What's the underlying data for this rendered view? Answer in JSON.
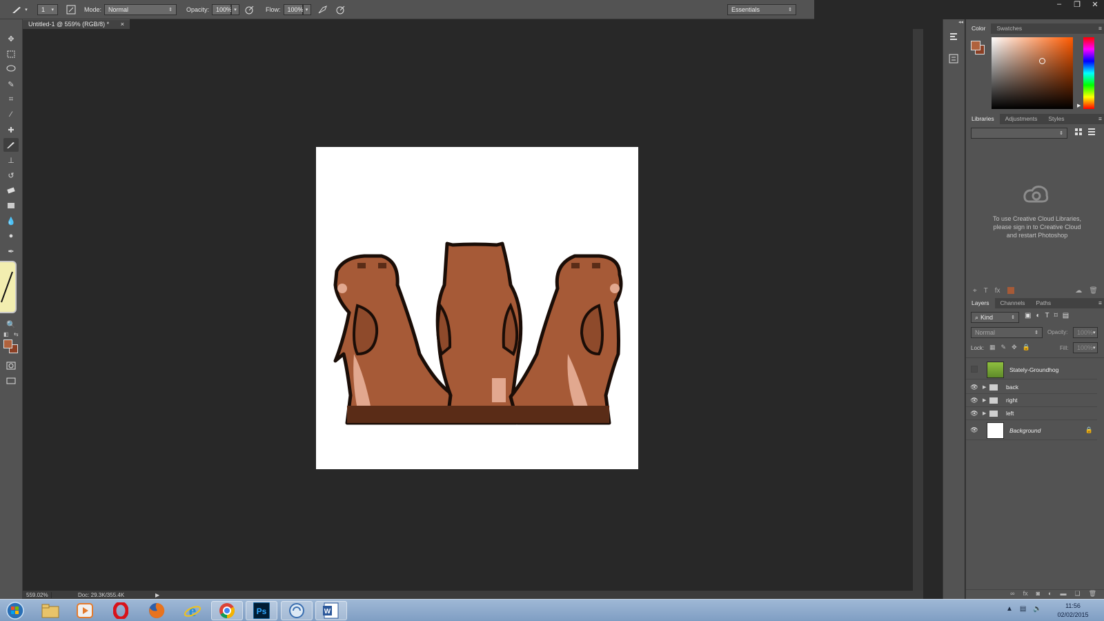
{
  "options_bar": {
    "brush_size": "1",
    "mode_label": "Mode:",
    "mode_value": "Normal",
    "opacity_label": "Opacity:",
    "opacity_value": "100%",
    "flow_label": "Flow:",
    "flow_value": "100%",
    "workspace": "Essentials"
  },
  "document": {
    "tab_title": "Untitled-1 @ 559% (RGB/8) *",
    "close": "×"
  },
  "status": {
    "zoom": "559.02%",
    "doc_size": "Doc: 29.3K/355.4K"
  },
  "colors": {
    "foreground": "#b0623d",
    "background": "#8a3f24",
    "canvas": "#ffffff"
  },
  "color_panel": {
    "tabs": [
      "Color",
      "Swatches"
    ]
  },
  "libraries_panel": {
    "tabs": [
      "Libraries",
      "Adjustments",
      "Styles"
    ],
    "message_line1": "To use Creative Cloud Libraries,",
    "message_line2": "please sign in to Creative Cloud",
    "message_line3": "and restart Photoshop"
  },
  "layers_panel": {
    "tabs": [
      "Layers",
      "Channels",
      "Paths"
    ],
    "filter": "Kind",
    "blend_mode": "Normal",
    "opacity_label": "Opacity:",
    "opacity_value": "100%",
    "lock_label": "Lock:",
    "fill_label": "Fill:",
    "fill_value": "100%",
    "layers": [
      {
        "name": "Stately-Groundhog",
        "type": "image",
        "visible": false
      },
      {
        "name": "back",
        "type": "group",
        "visible": true
      },
      {
        "name": "right",
        "type": "group",
        "visible": true
      },
      {
        "name": "left",
        "type": "group",
        "visible": true
      },
      {
        "name": "Background",
        "type": "background",
        "visible": true,
        "locked": true
      }
    ]
  },
  "taskbar": {
    "time": "11:56",
    "date": "02/02/2015",
    "apps": [
      "start-orb-icon",
      "file-explorer-icon",
      "media-player-icon",
      "opera-icon",
      "firefox-icon",
      "internet-explorer-icon",
      "chrome-icon",
      "photoshop-icon",
      "sync-icon",
      "word-icon"
    ]
  }
}
